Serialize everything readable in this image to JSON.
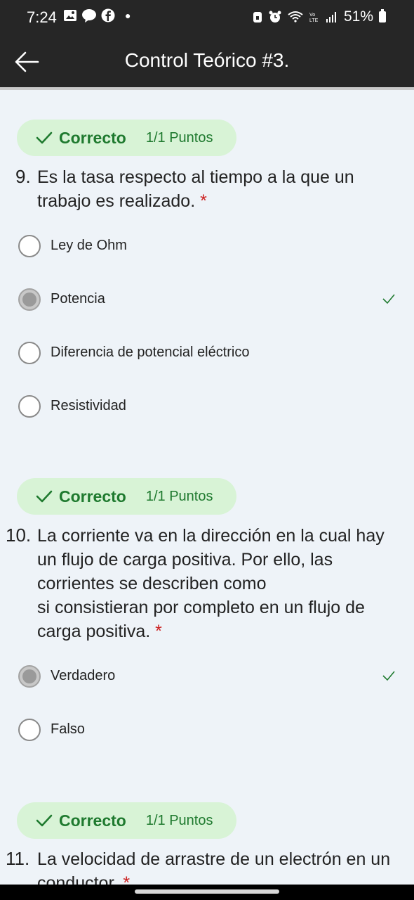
{
  "status_bar": {
    "time": "7:24",
    "left_icons": [
      "image-icon",
      "chat-icon",
      "facebook-icon"
    ],
    "right_icons": [
      "lock-icon",
      "alarm-icon",
      "wifi-icon",
      "volte-icon",
      "signal-icon"
    ],
    "battery": "51%"
  },
  "app_bar": {
    "title": "Control Teórico #3."
  },
  "questions": [
    {
      "number": "9.",
      "status": "Correcto",
      "points": "1/1 Puntos",
      "text": "Es la tasa respecto al tiempo a la que un trabajo es realizado.",
      "required": "*",
      "options": [
        {
          "label": "Ley de Ohm",
          "selected": false,
          "correct": false
        },
        {
          "label": "Potencia",
          "selected": true,
          "correct": true
        },
        {
          "label": "Diferencia de potencial eléctrico",
          "selected": false,
          "correct": false
        },
        {
          "label": "Resistividad",
          "selected": false,
          "correct": false
        }
      ]
    },
    {
      "number": "10.",
      "status": "Correcto",
      "points": "1/1 Puntos",
      "text_lines": [
        "La corriente va en la dirección en la cual hay",
        "un flujo de carga positiva. Por ello, las",
        "corrientes se describen como",
        "si consistieran por completo en un flujo de",
        "carga positiva."
      ],
      "required": "*",
      "options": [
        {
          "label": "Verdadero",
          "selected": true,
          "correct": true
        },
        {
          "label": "Falso",
          "selected": false,
          "correct": false
        }
      ]
    },
    {
      "number": "11.",
      "status": "Correcto",
      "points": "1/1 Puntos",
      "text": "La velocidad de arrastre de un electrón en un conductor.",
      "required": "*"
    }
  ],
  "colors": {
    "status_green": "#1f7a2f",
    "pill_bg": "#d8f3d6",
    "page_bg": "#eef3f8",
    "bar_bg": "#262626",
    "required_red": "#c22"
  }
}
